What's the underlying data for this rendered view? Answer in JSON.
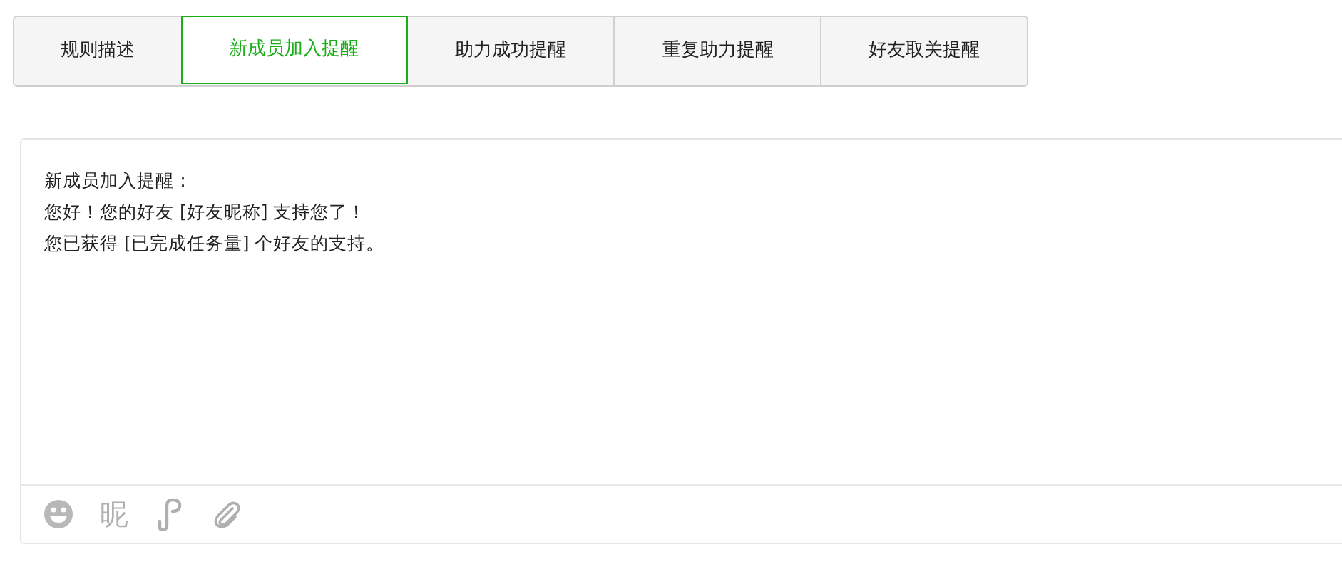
{
  "tabs": [
    {
      "label": "规则描述",
      "selected": false
    },
    {
      "label": "新成员加入提醒",
      "selected": true
    },
    {
      "label": "助力成功提醒",
      "selected": false
    },
    {
      "label": "重复助力提醒",
      "selected": false
    },
    {
      "label": "好友取关提醒",
      "selected": false
    }
  ],
  "editor": {
    "lines": [
      "新成员加入提醒：",
      "您好！您的好友 [好友昵称] 支持您了！",
      "您已获得 [已完成任务量] 个好友的支持。"
    ],
    "toolbar": [
      {
        "kind": "emoji"
      },
      {
        "kind": "text",
        "label": "昵"
      },
      {
        "kind": "link"
      },
      {
        "kind": "attach"
      }
    ]
  }
}
